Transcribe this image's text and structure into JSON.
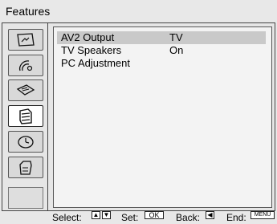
{
  "header": {
    "title": "Features"
  },
  "sidebar": {
    "items": [
      {
        "icon": "picture-icon"
      },
      {
        "icon": "sound-icon"
      },
      {
        "icon": "screen-icon"
      },
      {
        "icon": "features-icon",
        "selected": true
      },
      {
        "icon": "timer-icon"
      },
      {
        "icon": "setup-icon"
      }
    ]
  },
  "menu": {
    "rows": [
      {
        "label": "AV2 Output",
        "value": "TV",
        "selected": true
      },
      {
        "label": "TV Speakers",
        "value": "On"
      },
      {
        "label": "PC Adjustment",
        "value": ""
      }
    ]
  },
  "footer": {
    "select_label": "Select:",
    "set_label": "Set:",
    "set_key": "OK",
    "back_label": "Back:",
    "end_label": "End:",
    "end_key": "MENU"
  }
}
